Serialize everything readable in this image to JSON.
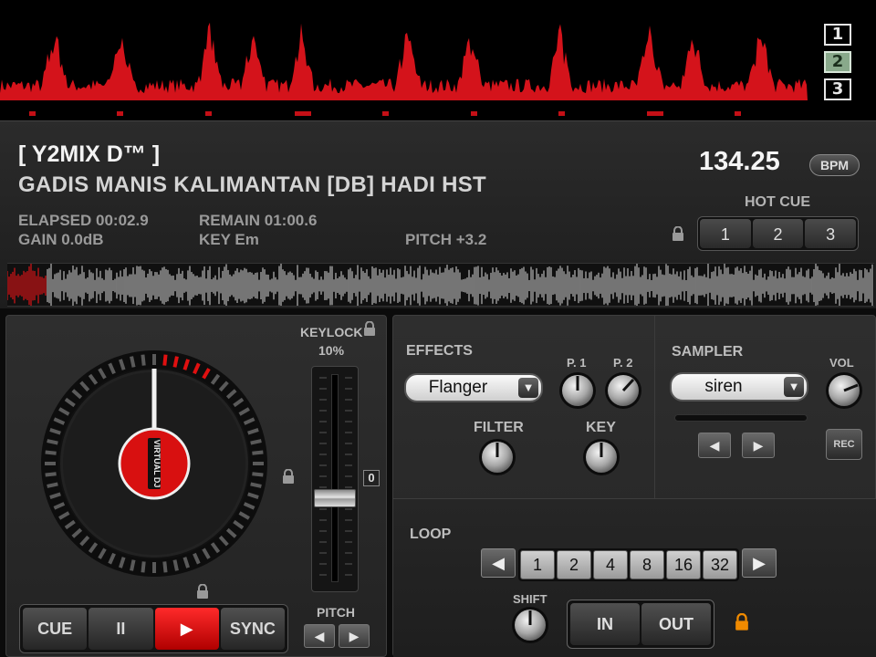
{
  "overview": {
    "decks": [
      {
        "label": "1",
        "active": false
      },
      {
        "label": "2",
        "active": true
      },
      {
        "label": "3",
        "active": false
      }
    ],
    "waveform_color": "#d4131b"
  },
  "info": {
    "artist": "[ Y2MIX D™ ]",
    "track": "GADIS MANIS KALIMANTAN [DB] HADI HST",
    "elapsed": "ELAPSED 00:02.9",
    "remain": "REMAIN 01:00.6",
    "gain": "GAIN 0.0dB",
    "key": "KEY Em",
    "pitch": "PITCH +3.2",
    "bpm": "134.25",
    "bpm_unit": "BPM",
    "hot_cue_label": "HOT CUE",
    "hot_cues": [
      "1",
      "2",
      "3"
    ]
  },
  "deck": {
    "platter_logo": "VIRTUAL DJ",
    "keylock_label": "KEYLOCK",
    "keylock_pct": "10%",
    "zero_label": "0",
    "pitch_position": 0.62,
    "transport": {
      "cue": "CUE",
      "pause": "II",
      "play": "▶",
      "sync": "SYNC"
    },
    "pitch_label": "PITCH",
    "pitch_left": "◀",
    "pitch_right": "▶"
  },
  "effects": {
    "label": "EFFECTS",
    "selected": "Flanger",
    "p1_label": "P. 1",
    "p2_label": "P. 2",
    "filter_label": "FILTER",
    "key_label": "KEY"
  },
  "sampler": {
    "label": "SAMPLER",
    "selected": "siren",
    "vol_label": "VOL",
    "prev": "◀",
    "next": "▶",
    "rec_label": "REC"
  },
  "loop": {
    "label": "LOOP",
    "prev": "◀",
    "next": "▶",
    "sizes": [
      "1",
      "2",
      "4",
      "8",
      "16",
      "32"
    ],
    "shift_label": "SHIFT",
    "in_label": "IN",
    "out_label": "OUT"
  },
  "colors": {
    "accent_red": "#e01010",
    "lock_orange": "#f08a00",
    "deck_active": "#89a98b"
  },
  "dropdown_icon": "triangle-down-icon"
}
